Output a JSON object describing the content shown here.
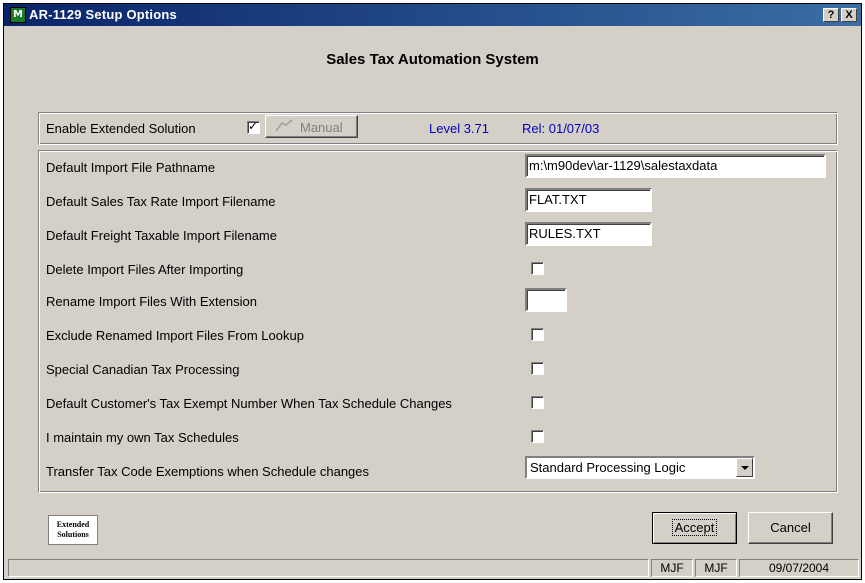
{
  "window": {
    "title": "AR-1129  Setup Options",
    "help_button": "?",
    "close_button": "X",
    "app_icon": "M"
  },
  "heading": "Sales Tax Automation System",
  "top_panel": {
    "enable_label": "Enable Extended Solution",
    "enable_checked": true,
    "manual_label": "Manual",
    "level": "Level 3.71",
    "release": "Rel: 01/07/03"
  },
  "fields": {
    "import_path_label": "Default Import File Pathname",
    "import_path_value": "m:\\m90dev\\ar-1129\\salestaxdata",
    "rate_file_label": "Default Sales Tax Rate Import Filename",
    "rate_file_value": "FLAT.TXT",
    "freight_file_label": "Default Freight Taxable Import Filename",
    "freight_file_value": "RULES.TXT",
    "delete_label": "Delete Import Files After Importing",
    "rename_label": "Rename Import Files With Extension",
    "rename_value": "",
    "exclude_label": "Exclude Renamed Import Files From Lookup",
    "canadian_label": "Special Canadian Tax Processing",
    "exempt_label": "Default Customer's Tax Exempt Number When Tax Schedule Changes",
    "own_schedules_label": "I maintain my own Tax Schedules",
    "transfer_label": "Transfer Tax Code Exemptions when Schedule changes",
    "transfer_value": "Standard Processing Logic"
  },
  "footer": {
    "logo_line1": "Extended",
    "logo_line2": "Solutions",
    "accept_label": "Accept",
    "cancel_label": "Cancel"
  },
  "status": {
    "panel1": "MJF",
    "panel2": "MJF",
    "date": "09/07/2004"
  }
}
